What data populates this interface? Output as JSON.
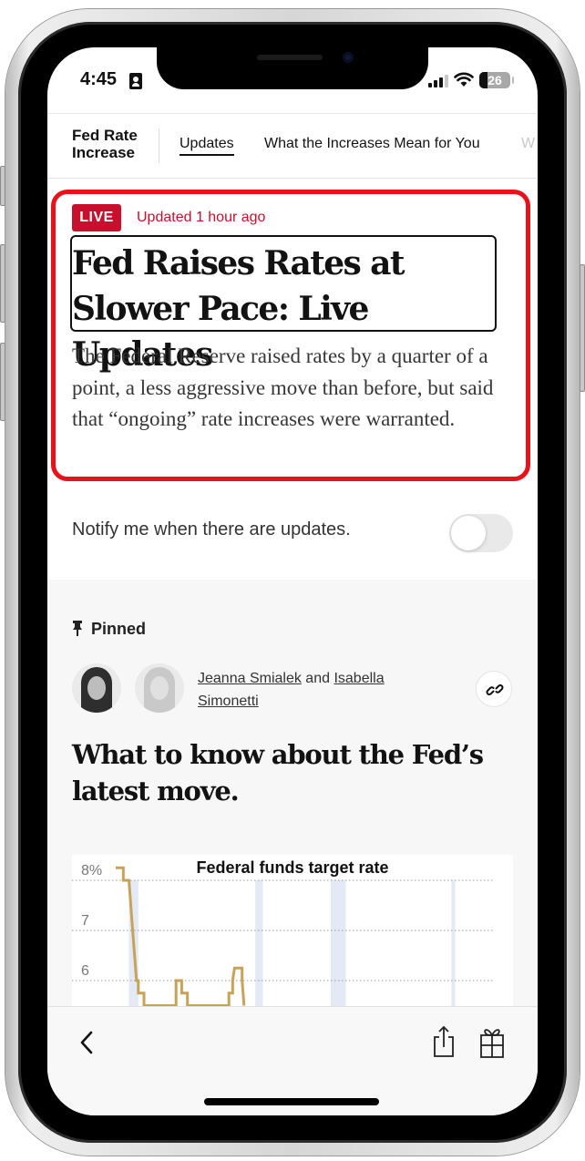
{
  "status_bar": {
    "time": "4:45",
    "battery": "26"
  },
  "section_nav": {
    "section_title": "Fed Rate Increase",
    "tabs": [
      {
        "label": "Updates",
        "active": true
      },
      {
        "label": "What the Increases Mean for You",
        "active": false
      },
      {
        "label": "W",
        "active": false
      }
    ]
  },
  "article": {
    "live_badge": "LIVE",
    "updated": "Updated 1 hour ago",
    "headline": "Fed Raises Rates at Slower Pace: Live Updates",
    "summary": "The Federal Reserve raised rates by a quarter of a point, a less aggressive move than before, but said that “ongoing” rate increases were warranted."
  },
  "notify": {
    "label": "Notify me when there are updates.",
    "enabled": false
  },
  "pinned": {
    "label": "Pinned",
    "authors": [
      "Jeanna Smialek",
      "Isabella Simonetti"
    ],
    "author_joiner": "and",
    "title": "What to know about the Fed’s latest move."
  },
  "chart_data": {
    "type": "line",
    "title": "Federal funds target rate",
    "xlabel": "",
    "ylabel": "",
    "y_tick_labels": [
      "8%",
      "7",
      "6"
    ],
    "y_ticks": [
      8,
      7,
      6
    ],
    "ylim": [
      5.5,
      8.3
    ],
    "grid": true,
    "series": [
      {
        "name": "Federal funds target rate",
        "color": "#c9a25a",
        "step_points": [
          [
            0.0,
            8.25
          ],
          [
            0.02,
            8.25
          ],
          [
            0.02,
            8.0
          ],
          [
            0.035,
            8.0
          ],
          [
            0.045,
            7.0
          ],
          [
            0.055,
            6.0
          ],
          [
            0.06,
            6.0
          ],
          [
            0.06,
            5.75
          ],
          [
            0.075,
            5.75
          ],
          [
            0.075,
            5.5
          ],
          [
            0.16,
            5.5
          ],
          [
            0.16,
            6.0
          ],
          [
            0.175,
            6.0
          ],
          [
            0.175,
            5.75
          ],
          [
            0.19,
            5.75
          ],
          [
            0.19,
            5.5
          ],
          [
            0.3,
            5.5
          ],
          [
            0.3,
            5.75
          ],
          [
            0.31,
            5.75
          ],
          [
            0.31,
            6.0
          ],
          [
            0.315,
            6.25
          ],
          [
            0.335,
            6.25
          ],
          [
            0.335,
            6.0
          ],
          [
            0.34,
            5.5
          ]
        ]
      }
    ],
    "recession_bands": [
      [
        0.035,
        0.06
      ],
      [
        0.37,
        0.39
      ],
      [
        0.57,
        0.61
      ],
      [
        0.89,
        0.9
      ]
    ],
    "recession_color": "#e3eaf6"
  },
  "toolbar": {
    "back_label": "Back",
    "share_label": "Share",
    "gift_label": "Gift article"
  }
}
